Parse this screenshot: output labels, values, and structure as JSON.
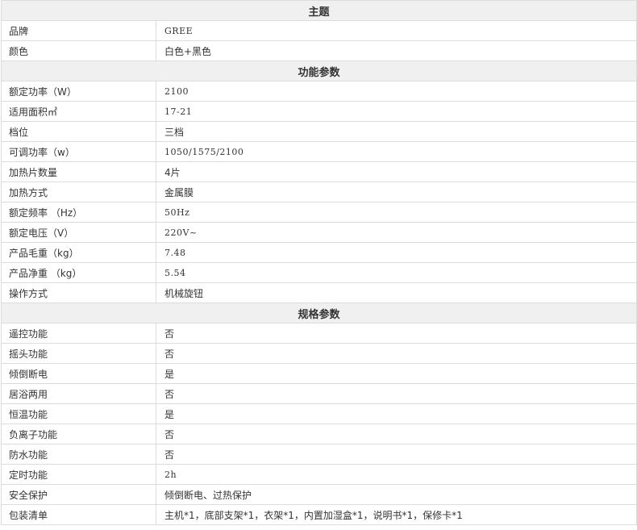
{
  "sections": [
    {
      "title": "主题",
      "rows": [
        {
          "label": "品牌",
          "value": "GREE"
        },
        {
          "label": "颜色",
          "value": "白色+黑色"
        }
      ]
    },
    {
      "title": "功能参数",
      "rows": [
        {
          "label": "额定功率（W）",
          "value": "2100"
        },
        {
          "label": "适用面积㎡",
          "value": "17-21"
        },
        {
          "label": "档位",
          "value": "三档"
        },
        {
          "label": "可调功率（w）",
          "value": "1050/1575/2100"
        },
        {
          "label": "加热片数量",
          "value": "4片"
        },
        {
          "label": "加热方式",
          "value": "金属膜"
        },
        {
          "label": "额定频率 （Hz）",
          "value": "50Hz"
        },
        {
          "label": "额定电压（V）",
          "value": "220V~"
        },
        {
          "label": "产品毛重（kg）",
          "value": "7.48"
        },
        {
          "label": "产品净重 （kg）",
          "value": "5.54"
        },
        {
          "label": "操作方式",
          "value": "机械旋钮"
        }
      ]
    },
    {
      "title": "规格参数",
      "rows": [
        {
          "label": "遥控功能",
          "value": "否"
        },
        {
          "label": "摇头功能",
          "value": "否"
        },
        {
          "label": "倾倒断电",
          "value": "是"
        },
        {
          "label": "居浴两用",
          "value": "否"
        },
        {
          "label": "恒温功能",
          "value": "是"
        },
        {
          "label": "负离子功能",
          "value": "否"
        },
        {
          "label": "防水功能",
          "value": "否"
        },
        {
          "label": "定时功能",
          "value": "2h"
        },
        {
          "label": "安全保护",
          "value": "倾倒断电、过热保护"
        },
        {
          "label": "包装清单",
          "value": "主机*1，底部支架*1，衣架*1，内置加湿盒*1，说明书*1，保修卡*1"
        }
      ]
    }
  ]
}
